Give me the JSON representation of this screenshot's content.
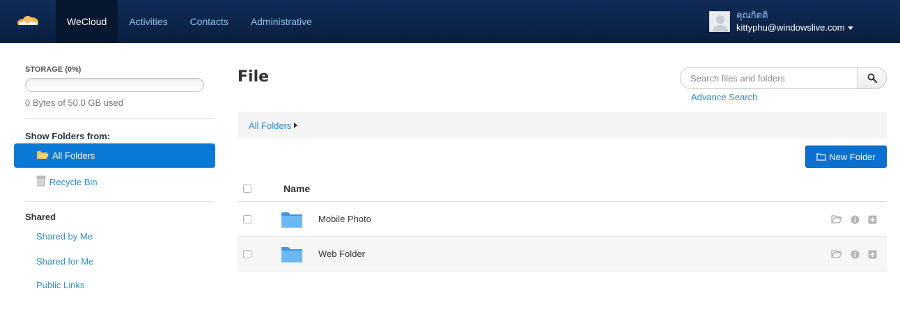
{
  "nav": {
    "brand": "WeCloud",
    "items": [
      "Activities",
      "Contacts",
      "Administrative"
    ]
  },
  "user": {
    "name": "คุณกิตติ",
    "email": "kittyphu@windowslive.com"
  },
  "sidebar": {
    "storage_label": "STORAGE (0%)",
    "storage_percent": 0,
    "storage_used": "0 Bytes of 50.0 GB used",
    "show_folders_title": "Show Folders from:",
    "folders": [
      {
        "label": "All Folders",
        "selected": true
      },
      {
        "label": "Recycle Bin",
        "selected": false
      }
    ],
    "shared_title": "Shared",
    "shared_links": [
      "Shared by Me",
      "Shared for Me",
      "Public Links"
    ]
  },
  "main": {
    "title": "File",
    "search_placeholder": "Search files and folders",
    "advance_search": "Advance Search",
    "breadcrumb": "All Folders",
    "new_folder": "New Folder",
    "column_name": "Name",
    "rows": [
      {
        "name": "Mobile Photo"
      },
      {
        "name": "Web Folder"
      }
    ]
  },
  "colors": {
    "nav_bg": "#0f2c57",
    "accent": "#0a79d6",
    "link": "#2a8fc9",
    "folder": "#5aaef0"
  }
}
